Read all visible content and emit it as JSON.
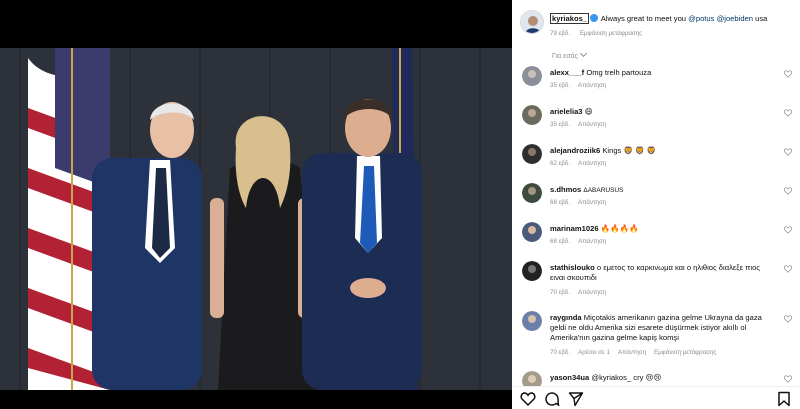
{
  "post": {
    "author": "kyriakos_",
    "caption_prefix": "Always great to meet you",
    "mention_1": "@potus",
    "mention_2": "@joebiden",
    "caption_suffix": "usa",
    "time": "79 εβδ.",
    "see_translation": "Εμφάνιση μετάφρασης"
  },
  "for_you_label": "Για εσάς",
  "reply_label": "Απάντηση",
  "translation_label": "Εμφάνιση μετάφρασης",
  "comments": [
    {
      "user": "alexx___f",
      "text": "Omg trelh partouza",
      "time": "35 εβδ.",
      "avatar_color": "#8a8f9a"
    },
    {
      "user": "arielelia3",
      "text": "😄",
      "time": "35 εβδ.",
      "avatar_color": "#6d6a5e"
    },
    {
      "user": "alejandroziik6",
      "text": "Kings 🦁 🦁 🦁",
      "time": "62 εβδ.",
      "avatar_color": "#2f2f2f"
    },
    {
      "user": "s.dhmos",
      "text": "ΔΑΒΑRUSUS",
      "time": "68 εβδ.",
      "avatar_color": "#3c4b3e"
    },
    {
      "user": "marinam1026",
      "text": "🔥🔥🔥🔥",
      "time": "68 εβδ.",
      "avatar_color": "#4b5a7a"
    },
    {
      "user": "stathislouko",
      "text": "ο εμετος το καρκινωμα και ο ηλιθιος διαλεξε πιος ειναι σκουπιδι",
      "time": "70 εβδ.",
      "avatar_color": "#222222"
    },
    {
      "user": "raygında",
      "text": "Miçotakis amerikanın gazina gelme Ukrayna da gaza geldi ne oldu Amerika sizi esarete düşürmek istiyor akıllı ol Amerika'nın gazina gelme kapiş komşi",
      "time": "70 εβδ.",
      "likes": "Αρέσει σε 1",
      "avatar_color": "#6b7fa8"
    },
    {
      "user": "yason34ua",
      "text": "@kyriakos_ cry 😢😢",
      "time": "",
      "avatar_color": "#a39a8a"
    }
  ]
}
